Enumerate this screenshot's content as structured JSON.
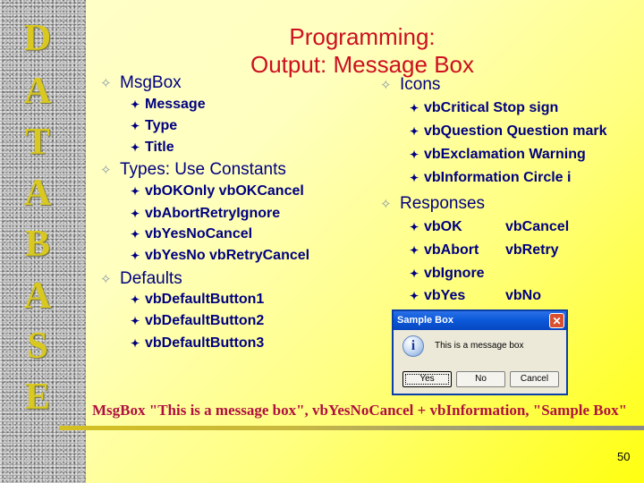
{
  "sidebar": {
    "letters": [
      "D",
      "A",
      "T",
      "A",
      "B",
      "A",
      "S",
      "E"
    ]
  },
  "title": {
    "line1": "Programming:",
    "line2": "Output:  Message Box"
  },
  "left": {
    "sections": [
      {
        "heading": "MsgBox",
        "items": [
          "Message",
          "Type",
          "Title"
        ]
      },
      {
        "heading": "Types:  Use Constants",
        "items": [
          "vbOKOnly vbOKCancel",
          "vbAbortRetryIgnore",
          "vbYesNoCancel",
          "vbYesNo  vbRetryCancel"
        ]
      },
      {
        "heading": "Defaults",
        "items": [
          "vbDefaultButton1",
          "vbDefaultButton2",
          "vbDefaultButton3"
        ]
      }
    ]
  },
  "right": {
    "icons": {
      "heading": "Icons",
      "items": [
        "vbCritical  Stop sign",
        "vbQuestion Question mark",
        "vbExclamation  Warning",
        "vbInformation  Circle i"
      ]
    },
    "responses": {
      "heading": "Responses",
      "items": [
        {
          "a": "vbOK",
          "b": "vbCancel"
        },
        {
          "a": "vbAbort",
          "b": "vbRetry"
        },
        {
          "a": "vbIgnore",
          "b": ""
        },
        {
          "a": "vbYes",
          "b": "vbNo"
        }
      ]
    }
  },
  "dialog": {
    "title": "Sample Box",
    "close_glyph": "✕",
    "icon": "information-icon",
    "icon_glyph": "i",
    "message": "This is a message box",
    "buttons": [
      "Yes",
      "No",
      "Cancel"
    ],
    "default_button": "Yes"
  },
  "caption": "MsgBox \"This is a message box\",  vbYesNoCancel + vbInformation, \"Sample Box\"",
  "page_number": "50",
  "glyphs": {
    "bullet1": "✧",
    "bullet2": "✦"
  },
  "colors": {
    "title": "#CC1020",
    "body_text": "#000080",
    "caption": "#B01040",
    "sidebar_letters": "#D8C820"
  }
}
